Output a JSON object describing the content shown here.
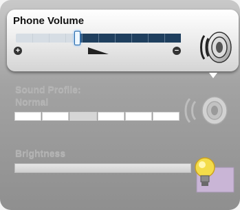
{
  "volume": {
    "title": "Phone Volume",
    "level_fraction": 0.37,
    "increase_symbol": "+",
    "decrease_symbol": "−",
    "icon": "speaker-icon"
  },
  "sound_profile": {
    "label": "Sound Profile:",
    "value": "Normal",
    "segments": 6,
    "selected_index": 2,
    "icon": "speaker-soft-icon"
  },
  "brightness": {
    "label": "Brightness",
    "icon": "light-bulb-icon"
  },
  "colors": {
    "volume_fill": "#1f3f5e",
    "panel_bg": "#a3a3a3",
    "dim_text": "#b3b3b3"
  }
}
